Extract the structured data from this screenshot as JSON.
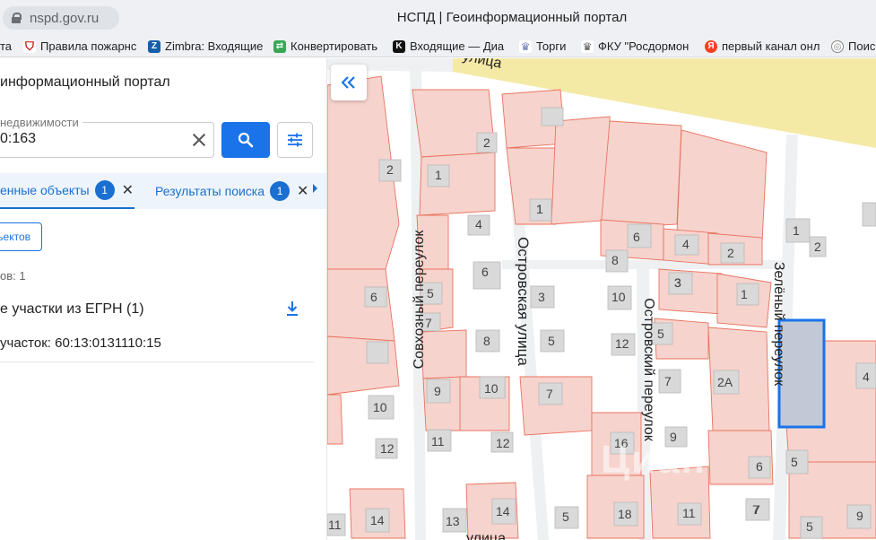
{
  "browser": {
    "url": "nspd.gov.ru",
    "title": "НСПД | Геоинформационный портал",
    "bookmarks": [
      {
        "label": "та",
        "icon": "none"
      },
      {
        "label": "Правила пожарнс",
        "icon": "shield-icon"
      },
      {
        "label": "Zimbra: Входящие",
        "icon": "zimbra-icon"
      },
      {
        "label": "Конвертировать",
        "icon": "convert-icon"
      },
      {
        "label": "Входящие — Диа",
        "icon": "k-icon"
      },
      {
        "label": "Торги",
        "icon": "emblem-icon"
      },
      {
        "label": "ФКУ \"Росдормон",
        "icon": "emblem-icon"
      },
      {
        "label": "первый канал онл",
        "icon": "yandex-icon"
      },
      {
        "label": "Поис",
        "icon": "search-site-icon"
      }
    ]
  },
  "panel": {
    "title": "информационный портал",
    "search_label": "недвижимости",
    "search_value": "0:163",
    "tabs": [
      {
        "label": "енные объекты",
        "count": "1"
      },
      {
        "label": "Результаты поиска",
        "count": "1"
      }
    ],
    "select_button": "ъектов",
    "count_text": "ов: 1",
    "group_title": "е участки из ЕГРН (1)",
    "item_text": "участок: 60:13:0131110:15"
  },
  "map": {
    "streets": {
      "top": "улица",
      "sovkhozny": "Совхозный переулок",
      "ostrovskaya": "Островская улица",
      "ostrovsky_per": "Островский переулок",
      "zeleny": "Зелёный переулок",
      "bottom": "улица"
    },
    "house_numbers": [
      "2",
      "1",
      "2",
      "4",
      "6",
      "1",
      "3",
      "5",
      "6",
      "8",
      "5",
      "7",
      "9",
      "10",
      "12",
      "11",
      "10",
      "12",
      "13",
      "14",
      "14",
      "1",
      "3",
      "5",
      "7",
      "5",
      "8",
      "10",
      "12",
      "7",
      "9",
      "16",
      "18",
      "11",
      "6",
      "4",
      "2",
      "3",
      "1",
      "5",
      "2А",
      "7",
      "6",
      "5",
      "1",
      "2",
      "4",
      "7",
      "9",
      "11"
    ],
    "watermark": "Циан"
  },
  "colors": {
    "accent": "#1a73e8",
    "parcel_fill": "#f7d3cd",
    "parcel_stroke": "#e8735f",
    "selected_fill": "#c3c8d6",
    "selected_stroke": "#1a73e8",
    "road": "#f5e9a6"
  }
}
